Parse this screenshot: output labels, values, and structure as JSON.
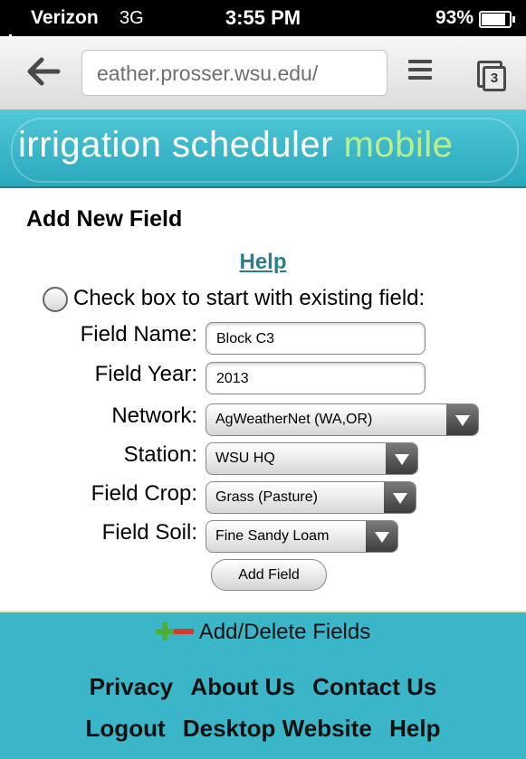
{
  "status_bar": {
    "carrier": "Verizon",
    "network": "3G",
    "time": "3:55 PM",
    "battery_percent": "93%",
    "battery_level": 0.93
  },
  "browser": {
    "url": "eather.prosser.wsu.edu/",
    "tab_count": "3"
  },
  "banner": {
    "title_main": "irrigation scheduler ",
    "title_accent": "mobile"
  },
  "form": {
    "title": "Add New Field",
    "help_link": "Help",
    "existing_checkbox_label": "Check box to start with existing field:",
    "field_name_label": "Field Name:",
    "field_name_value": "Block C3",
    "field_year_label": "Field Year:",
    "field_year_value": "2013",
    "network_label": "Network:",
    "network_value": "AgWeatherNet (WA,OR)",
    "station_label": "Station:",
    "station_value": "WSU HQ",
    "crop_label": "Field Crop:",
    "crop_value": "Grass (Pasture)",
    "soil_label": "Field Soil:",
    "soil_value": "Fine Sandy Loam",
    "submit_label": "Add Field"
  },
  "add_delete_bar": {
    "label": "Add/Delete Fields"
  },
  "footer": {
    "links_row1": [
      "Privacy",
      "About Us",
      "Contact Us"
    ],
    "links_row2": [
      "Logout",
      "Desktop Website",
      "Help"
    ]
  },
  "colors": {
    "accent_teal": "#3ab6c8",
    "link_teal": "#2a7f8c",
    "plus_green": "#4caf3a",
    "minus_red": "#d63a2c"
  }
}
